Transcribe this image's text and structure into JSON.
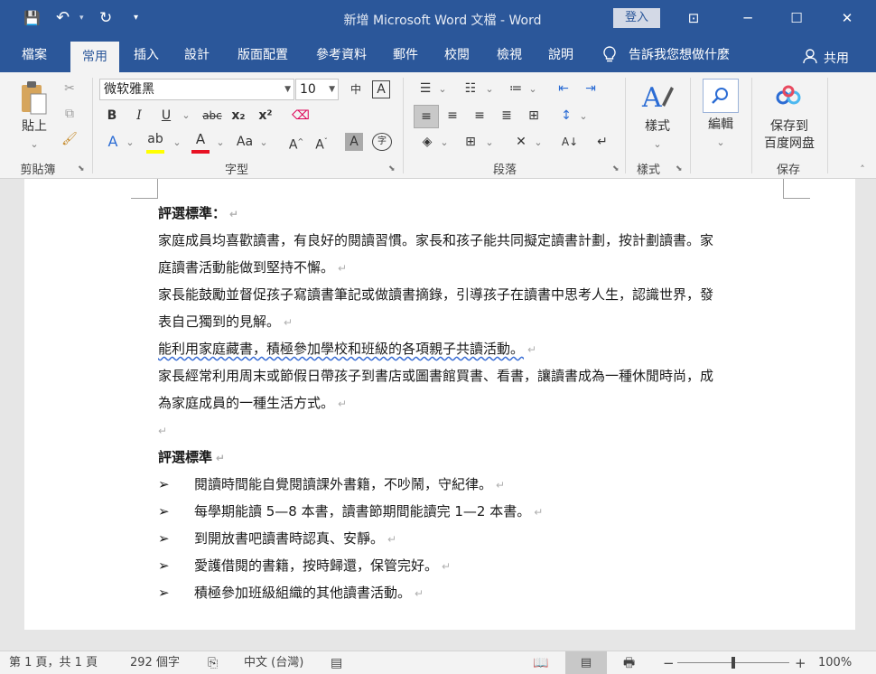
{
  "title_bar": {
    "title": "新增 Microsoft Word 文檔 - Word",
    "login_label": "登入",
    "qat": {
      "save_glyph": "💾",
      "undo_glyph": "↶",
      "redo_glyph": "↻",
      "more_glyph": "▾"
    },
    "window_buttons": {
      "ribbon_options": "⊡",
      "minimize": "─",
      "maximize": "☐",
      "close": "✕"
    }
  },
  "tabs": [
    {
      "label": "檔案",
      "active": false
    },
    {
      "label": "常用",
      "active": true
    },
    {
      "label": "插入",
      "active": false
    },
    {
      "label": "設計",
      "active": false
    },
    {
      "label": "版面配置",
      "active": false
    },
    {
      "label": "參考資料",
      "active": false
    },
    {
      "label": "郵件",
      "active": false
    },
    {
      "label": "校閱",
      "active": false
    },
    {
      "label": "檢視",
      "active": false
    },
    {
      "label": "說明",
      "active": false
    }
  ],
  "tell_me": "告訴我您想做什麼",
  "share_label": "共用",
  "ribbon": {
    "clipboard": {
      "paste_label": "貼上",
      "group_label": "剪貼簿"
    },
    "font": {
      "font_name": "微软雅黑",
      "font_size": "10",
      "group_label": "字型",
      "bold": "B",
      "italic": "I",
      "underline": "U",
      "strike": "abc",
      "subscript": "x₂",
      "superscript": "x²",
      "case": "Aa",
      "grow": "A",
      "shrink": "A",
      "phonetic": "中",
      "border_char": "A",
      "shade_char": "A",
      "enclose": "字",
      "font_color": "#e81123",
      "highlight_color": "#ffff00"
    },
    "paragraph": {
      "group_label": "段落"
    },
    "styles": {
      "label": "樣式",
      "group_label": "樣式"
    },
    "editing": {
      "label": "編輯"
    },
    "save": {
      "label_line1": "保存到",
      "label_line2": "百度网盘",
      "group_label": "保存"
    }
  },
  "document": {
    "lines": [
      {
        "text": "評選標準：",
        "bold": true,
        "mark": true
      },
      {
        "text": "家庭成員均喜歡讀書，有良好的閱讀習慣。家長和孩子能共同擬定讀書計劃，按計劃讀書。家",
        "bold": false,
        "mark": false
      },
      {
        "text": "庭讀書活動能做到堅持不懈。",
        "bold": false,
        "mark": true
      },
      {
        "text": "家長能鼓勵並督促孩子寫讀書筆記或做讀書摘錄，引導孩子在讀書中思考人生，認識世界，發",
        "bold": false,
        "mark": false
      },
      {
        "text": "表自己獨到的見解。",
        "bold": false,
        "mark": true
      },
      {
        "text": "能利用家庭藏書，積極參加學校和班級的各項親子共讀活動。",
        "bold": false,
        "mark": true
      },
      {
        "text": "家長經常利用周末或節假日帶孩子到書店或圖書館買書、看書，讓讀書成為一種休閒時尚，成",
        "bold": false,
        "mark": false
      },
      {
        "text": "為家庭成員的一種生活方式。",
        "bold": false,
        "mark": true
      },
      {
        "text": "",
        "bold": false,
        "mark": true
      },
      {
        "text": "評選標準",
        "bold": true,
        "mark": true
      }
    ],
    "bullet_glyph": "➢",
    "bullets": [
      "閱讀時間能自覺閱讀課外書籍，不吵鬧，守紀律。",
      "每學期能讀 5—8 本書，讀書節期間能讀完 1—2 本書。",
      "到開放書吧讀書時認真、安靜。",
      "愛護借閱的書籍，按時歸還，保管完好。",
      "積極參加班級組織的其他讀書活動。"
    ],
    "para_mark": "↵"
  },
  "status_bar": {
    "page": "第 1 頁，共 1 頁",
    "words": "292 個字",
    "language": "中文 (台灣)",
    "zoom_minus": "−",
    "zoom_plus": "+",
    "zoom": "100%",
    "zoom_fraction": 0.5
  }
}
